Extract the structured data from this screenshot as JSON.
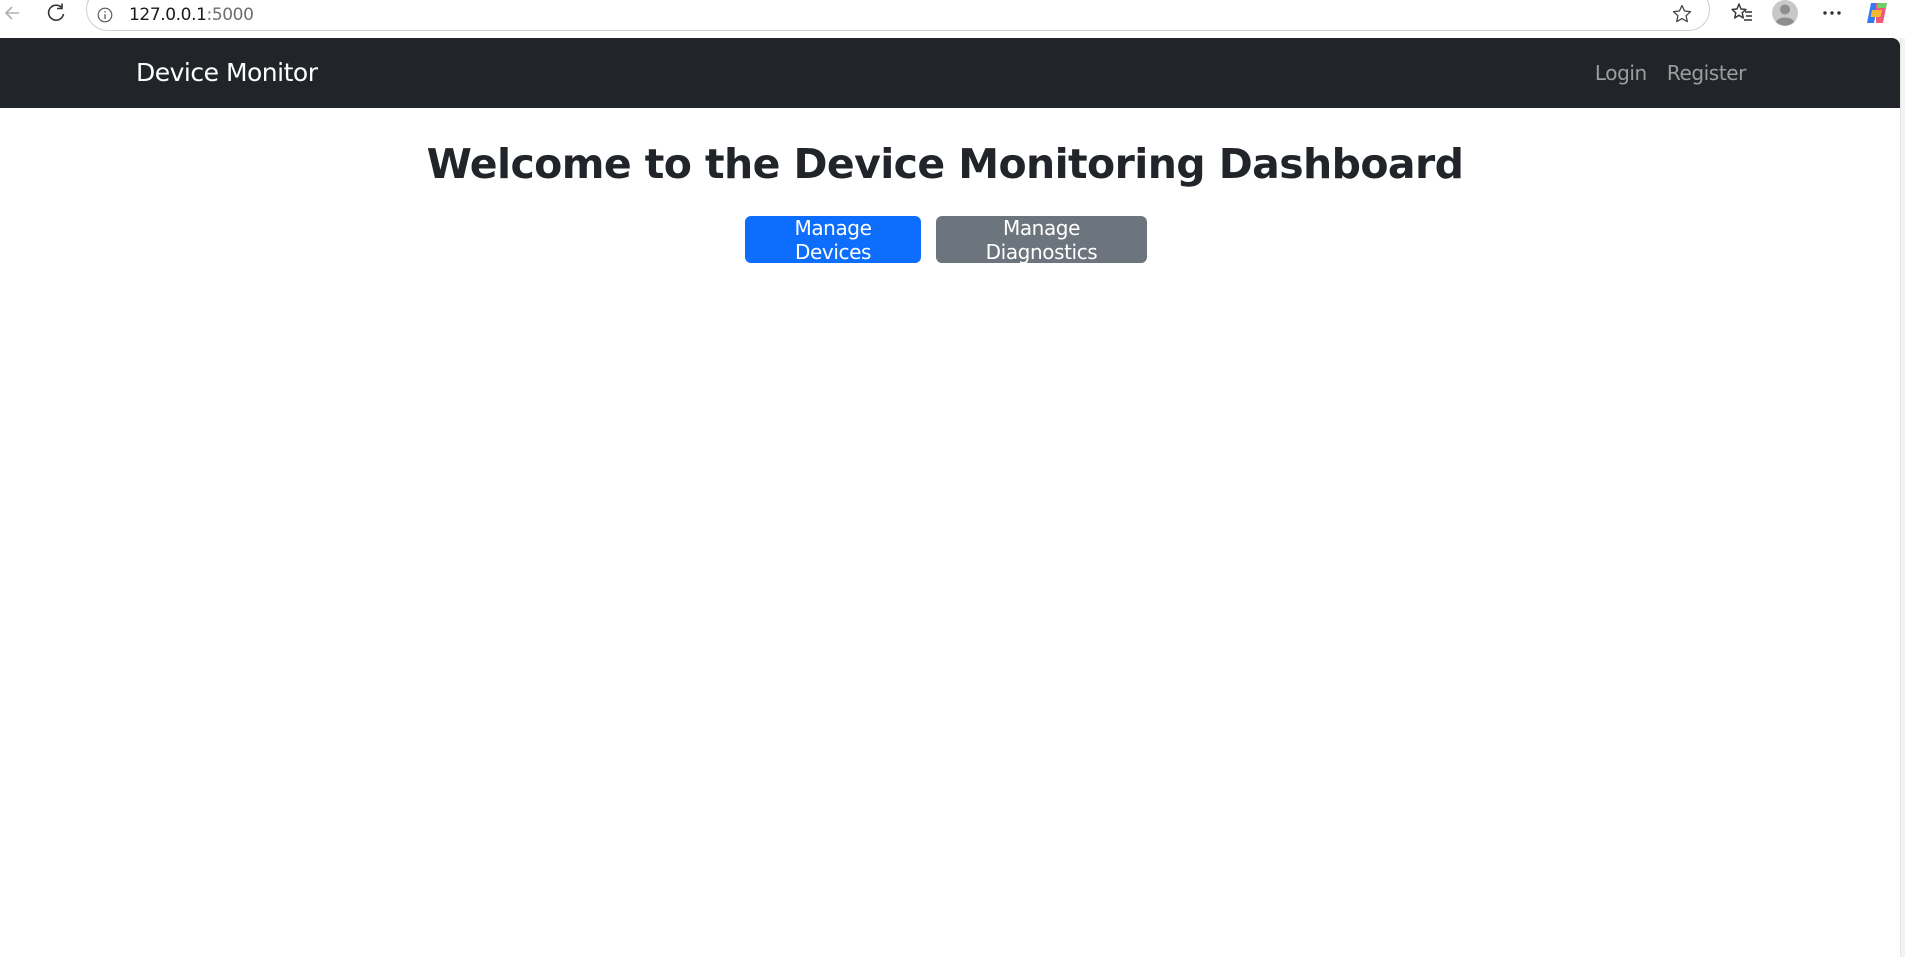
{
  "browser": {
    "url_host": "127.0.0.1",
    "url_port": ":5000"
  },
  "navbar": {
    "brand": "Device Monitor",
    "links": [
      {
        "label": "Login"
      },
      {
        "label": "Register"
      }
    ]
  },
  "main": {
    "title": "Welcome to the Device Monitoring Dashboard",
    "buttons": [
      {
        "label": "Manage Devices",
        "color": "#0d6efd"
      },
      {
        "label": "Manage Diagnostics",
        "color": "#6c757d"
      }
    ]
  },
  "colors": {
    "navbar_bg": "#212529",
    "primary": "#0d6efd",
    "secondary": "#6c757d"
  },
  "icons": [
    "back-arrow-icon",
    "reload-icon",
    "site-info-icon",
    "star-icon",
    "favorites-icon",
    "profile-icon",
    "more-icon",
    "copilot-icon"
  ]
}
